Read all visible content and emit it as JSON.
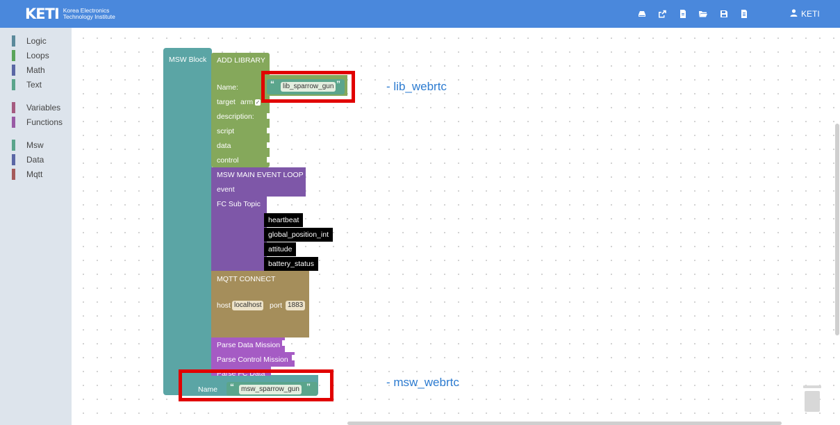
{
  "header": {
    "logo_mark": "KETI",
    "logo_line1": "Korea Electronics",
    "logo_line2": "Technology Institute",
    "user_name": "KETI",
    "toolbar_icons": [
      "drive-icon",
      "share-icon",
      "new-file-icon",
      "open-folder-icon",
      "save-icon",
      "export-file-icon"
    ]
  },
  "sidebar": {
    "categories": [
      {
        "label": "Logic",
        "color": "#5b8a9b"
      },
      {
        "label": "Loops",
        "color": "#5ba55b"
      },
      {
        "label": "Math",
        "color": "#5b67a5"
      },
      {
        "label": "Text",
        "color": "#5ba58c"
      },
      {
        "label": "Variables",
        "color": "#a55b80"
      },
      {
        "label": "Functions",
        "color": "#995ba5"
      },
      {
        "label": "Msw",
        "color": "#5ba58c"
      },
      {
        "label": "Data",
        "color": "#5b67a5"
      },
      {
        "label": "Mqtt",
        "color": "#a55b5b"
      }
    ]
  },
  "blocks": {
    "msw_block_label": "MSW Block",
    "add_library": "ADD LIBRARY",
    "name_label": "Name:",
    "lib_name_value": "lib_sparrow_gun",
    "target_label": "target",
    "target_value": "arm",
    "description_label": "description:",
    "script_label": "script",
    "data_label": "data",
    "control_label": "control",
    "main_event_loop": "MSW MAIN EVENT LOOP",
    "event_label": "event",
    "fc_sub_topic": "FC Sub Topic",
    "fc_topics": [
      "heartbeat",
      "global_position_int",
      "attitude",
      "battery_status"
    ],
    "mqtt_connect": "MQTT CONNECT",
    "host_label": "host",
    "host_value": "localhost",
    "port_label": "port",
    "port_value": "1883",
    "parse_data_mission": "Parse Data Mission",
    "parse_control_mission": "Parse Control Mission",
    "parse_fc_data": "Parse FC Data",
    "msw_name_label": "Name",
    "msw_name_value": "msw_sparrow_gun",
    "quote_open": "“",
    "quote_close": "”"
  },
  "annotations": {
    "lib": "- lib_webrtc",
    "msw": "- msw_webrtc"
  },
  "colors": {
    "header": "#4a88dc",
    "msw_teal": "#5ba5a5",
    "library_green": "#85a85b",
    "event_purple": "#7e57a8",
    "mqtt_brown": "#a58e5b",
    "parse_purple": "#a55bc4",
    "fc_black": "#000000",
    "highlight_red": "#e10000",
    "annotation_blue": "#2c7bd0"
  }
}
